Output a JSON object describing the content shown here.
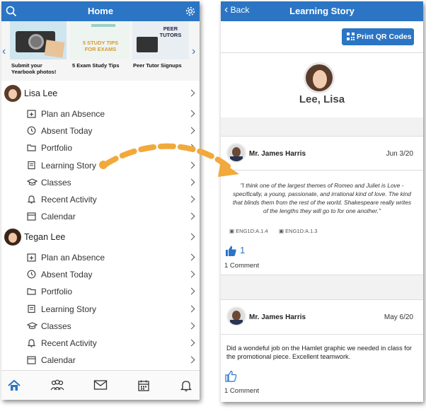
{
  "home": {
    "title": "Home",
    "carousel": [
      {
        "caption": "Submit your Yearbook photos!"
      },
      {
        "caption": "5 Exam Study Tips",
        "art_text": "5 STUDY TIPS FOR EXAMS"
      },
      {
        "caption": "Peer Tutor Signups",
        "art_text": "PEER TUTORS"
      }
    ],
    "students": [
      {
        "name": "Lisa Lee",
        "items": [
          "Plan an Absence",
          "Absent Today",
          "Portfolio",
          "Learning Story",
          "Classes",
          "Recent Activity",
          "Calendar"
        ]
      },
      {
        "name": "Tegan Lee",
        "items": [
          "Plan an Absence",
          "Absent Today",
          "Portfolio",
          "Learning Story",
          "Classes",
          "Recent Activity",
          "Calendar"
        ]
      }
    ],
    "item_icons": [
      "calendar-plus-icon",
      "clock-icon",
      "folder-icon",
      "book-icon",
      "graduation-cap-icon",
      "bell-icon",
      "calendar-icon"
    ],
    "bottom_tabs": [
      "home-icon",
      "people-icon",
      "mail-icon",
      "calendar-icon",
      "bell-icon"
    ]
  },
  "story": {
    "back_label": "Back",
    "title": "Learning Story",
    "print_button": "Print QR Codes",
    "student_name": "Lee, Lisa",
    "posts": [
      {
        "author": "Mr. James Harris",
        "date": "Jun 3/20",
        "quote": "\"I think one of the largest themes of Romeo and Juliet is Love - specifically, a young, passionate, and irrational kind of love. The kind that blinds them from the rest of the world. Shakespeare really writes of the lengths they will go to for one another.\"",
        "tags": [
          "ENG1D:A.1.4",
          "ENG1D:A.1.3"
        ],
        "likes": "1",
        "comments": "1 Comment"
      },
      {
        "author": "Mr. James Harris",
        "date": "May 6/20",
        "body": "Did a wondeful job on the Hamlet graphic we needed in class for the promotional piece. Excellent teamwork.",
        "comments": "1 Comment"
      }
    ]
  },
  "colors": {
    "brand_blue": "#2b75c4",
    "arrow_orange": "#f2a93b"
  }
}
